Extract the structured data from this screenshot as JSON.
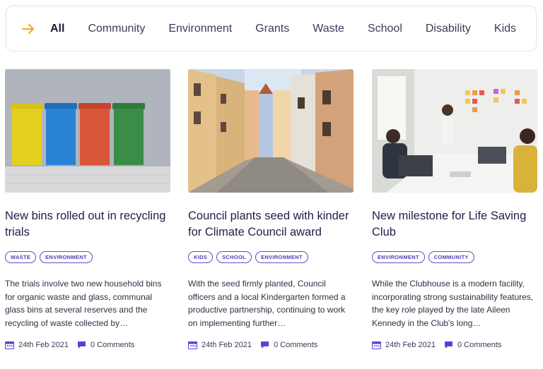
{
  "filters": {
    "arrow_icon": "arrow-right-icon",
    "accent_color": "#f5a623",
    "items": [
      {
        "label": "All",
        "active": true
      },
      {
        "label": "Community",
        "active": false
      },
      {
        "label": "Environment",
        "active": false
      },
      {
        "label": "Grants",
        "active": false
      },
      {
        "label": "Waste",
        "active": false
      },
      {
        "label": "School",
        "active": false
      },
      {
        "label": "Disability",
        "active": false
      },
      {
        "label": "Kids",
        "active": false
      }
    ]
  },
  "colors": {
    "tag": "#5a4fc9",
    "icon": "#5b3fd6",
    "title": "#1e1e4a"
  },
  "cards": [
    {
      "image": "recycling-bins-photo",
      "title": "New bins rolled out in recycling trials",
      "tags": [
        "WASTE",
        "ENVIRONMENT"
      ],
      "excerpt": "The trials involve two new household bins for organic waste and glass, communal glass bins at several reserves and the recycling of waste collected by…",
      "date": "24th Feb 2021",
      "comments": "0 Comments"
    },
    {
      "image": "town-street-photo",
      "title": "Council plants seed with kinder for Climate Council award",
      "tags": [
        "KIDS",
        "SCHOOL",
        "ENVIRONMENT"
      ],
      "excerpt": "With the seed firmly planted, Council officers and a local Kindergarten formed a productive partnership, continuing to work on implementing further…",
      "date": "24th Feb 2021",
      "comments": "0 Comments"
    },
    {
      "image": "office-meeting-photo",
      "title": "New milestone for Life Saving Club",
      "tags": [
        "ENVIRONMENT",
        "COMMUNITY"
      ],
      "excerpt": "While the Clubhouse is a modern facility, incorporating strong sustainability features, the key role played by the late Aileen Kennedy in the Club's long…",
      "date": "24th Feb 2021",
      "comments": "0 Comments"
    }
  ]
}
